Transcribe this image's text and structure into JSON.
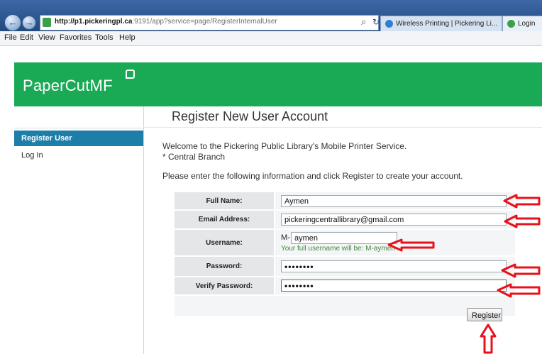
{
  "browser": {
    "url_host": "http://p1.pickeringpl.ca",
    "url_rest": ":9191/app?service=page/RegisterInternalUser",
    "tabs": [
      {
        "label": "Wireless Printing | Pickering Li..."
      },
      {
        "label": "Login"
      }
    ],
    "menu": [
      "File",
      "Edit",
      "View",
      "Favorites",
      "Tools",
      "Help"
    ]
  },
  "app": {
    "logo_text": "PaperCutMF",
    "brand_color": "#1aaa55",
    "nav_active_color": "#1d7eaa"
  },
  "sidebar": {
    "items": [
      {
        "label": "Register User",
        "active": true
      },
      {
        "label": "Log In",
        "active": false
      }
    ]
  },
  "main": {
    "title": "Register New User Account",
    "welcome_line1": "Welcome to the Pickering Public Library's Mobile Printer Service.",
    "welcome_line2": "* Central Branch",
    "instructions": "Please enter the following information and click Register to create your account."
  },
  "form": {
    "full_name": {
      "label": "Full Name:",
      "value": "Aymen"
    },
    "email": {
      "label": "Email Address:",
      "value": "pickeringcentrallibrary@gmail.com"
    },
    "username": {
      "label": "Username:",
      "prefix": "M-",
      "value": "aymen",
      "hint": "Your full username will be: M-aymen"
    },
    "password": {
      "label": "Password:",
      "value": "••••••••"
    },
    "verify_password": {
      "label": "Verify Password:",
      "value": "••••••••"
    },
    "register_label": "Register"
  },
  "annotation_color": "#e8101a"
}
